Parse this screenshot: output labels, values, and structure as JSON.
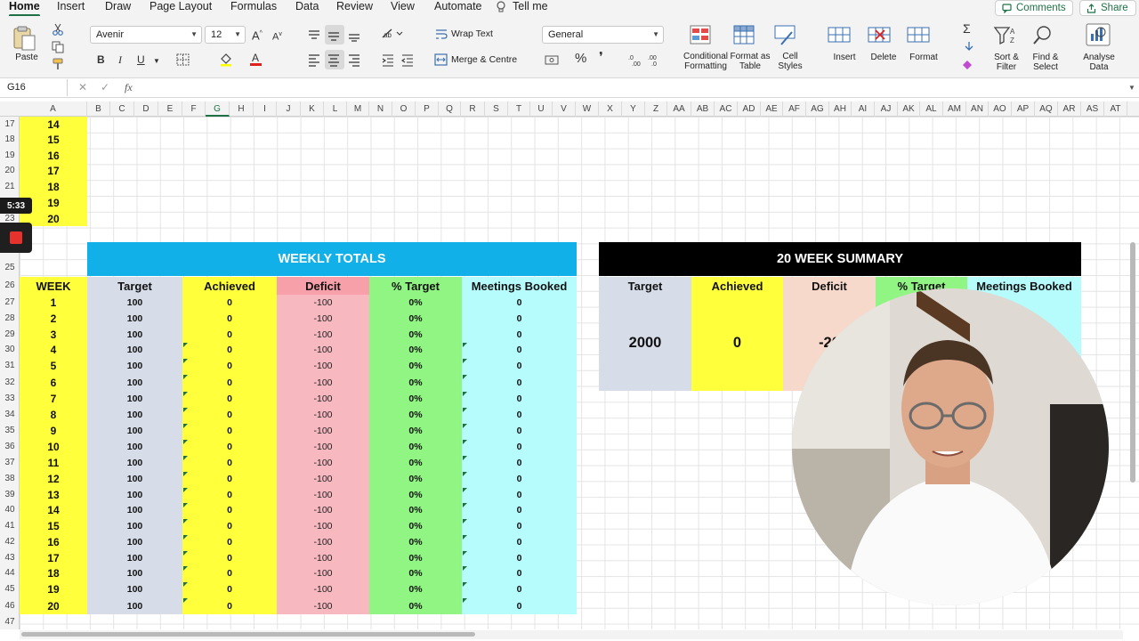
{
  "menu": {
    "tabs": [
      "Home",
      "Insert",
      "Draw",
      "Page Layout",
      "Formulas",
      "Data",
      "Review",
      "View",
      "Automate"
    ],
    "tell_me": "Tell me",
    "comments": "Comments",
    "share": "Share"
  },
  "ribbon": {
    "paste": "Paste",
    "font_name": "Avenir",
    "font_size": "12",
    "wrap_text": "Wrap Text",
    "merge_centre": "Merge & Centre",
    "number_format": "General",
    "conditional_formatting": "Conditional Formatting",
    "format_as_table": "Format as Table",
    "cell_styles": "Cell Styles",
    "insert": "Insert",
    "delete": "Delete",
    "format": "Format",
    "sort_filter": "Sort & Filter",
    "find_select": "Find & Select",
    "analyse_data": "Analyse Data",
    "bold": "B",
    "italic": "I",
    "underline": "U"
  },
  "formula_bar": {
    "name_box": "G16",
    "fx": "fx",
    "content": ""
  },
  "columns": [
    "A",
    "B",
    "C",
    "D",
    "E",
    "F",
    "G",
    "H",
    "I",
    "J",
    "K",
    "L",
    "M",
    "N",
    "O",
    "P",
    "Q",
    "R",
    "S",
    "T",
    "U",
    "V",
    "W",
    "X",
    "Y",
    "Z",
    "AA",
    "AB",
    "AC",
    "AD",
    "AE",
    "AF",
    "AG",
    "AH",
    "AI",
    "AJ",
    "AK",
    "AL",
    "AM",
    "AN",
    "AO",
    "AP",
    "AQ",
    "AR",
    "AS",
    "AT"
  ],
  "selected_column": "G",
  "rows": [
    "17",
    "18",
    "19",
    "20",
    "21",
    "22",
    "23",
    "",
    "25",
    "26",
    "27",
    "28",
    "29",
    "30",
    "31",
    "32",
    "33",
    "34",
    "35",
    "36",
    "37",
    "38",
    "39",
    "40",
    "41",
    "42",
    "43",
    "44",
    "45",
    "46",
    "47"
  ],
  "top_weeks": [
    "14",
    "15",
    "16",
    "17",
    "18",
    "19",
    "20"
  ],
  "weekly_totals": {
    "title": "WEEKLY TOTALS",
    "headers": [
      "WEEK",
      "Target",
      "Achieved",
      "Deficit",
      "% Target",
      "Meetings Booked"
    ],
    "rows": [
      [
        "1",
        "100",
        "0",
        "-100",
        "0%",
        "0"
      ],
      [
        "2",
        "100",
        "0",
        "-100",
        "0%",
        "0"
      ],
      [
        "3",
        "100",
        "0",
        "-100",
        "0%",
        "0"
      ],
      [
        "4",
        "100",
        "0",
        "-100",
        "0%",
        "0"
      ],
      [
        "5",
        "100",
        "0",
        "-100",
        "0%",
        "0"
      ],
      [
        "6",
        "100",
        "0",
        "-100",
        "0%",
        "0"
      ],
      [
        "7",
        "100",
        "0",
        "-100",
        "0%",
        "0"
      ],
      [
        "8",
        "100",
        "0",
        "-100",
        "0%",
        "0"
      ],
      [
        "9",
        "100",
        "0",
        "-100",
        "0%",
        "0"
      ],
      [
        "10",
        "100",
        "0",
        "-100",
        "0%",
        "0"
      ],
      [
        "11",
        "100",
        "0",
        "-100",
        "0%",
        "0"
      ],
      [
        "12",
        "100",
        "0",
        "-100",
        "0%",
        "0"
      ],
      [
        "13",
        "100",
        "0",
        "-100",
        "0%",
        "0"
      ],
      [
        "14",
        "100",
        "0",
        "-100",
        "0%",
        "0"
      ],
      [
        "15",
        "100",
        "0",
        "-100",
        "0%",
        "0"
      ],
      [
        "16",
        "100",
        "0",
        "-100",
        "0%",
        "0"
      ],
      [
        "17",
        "100",
        "0",
        "-100",
        "0%",
        "0"
      ],
      [
        "18",
        "100",
        "0",
        "-100",
        "0%",
        "0"
      ],
      [
        "19",
        "100",
        "0",
        "-100",
        "0%",
        "0"
      ],
      [
        "20",
        "100",
        "0",
        "-100",
        "0%",
        "0"
      ]
    ]
  },
  "summary": {
    "title": "20 WEEK SUMMARY",
    "headers": [
      "Target",
      "Achieved",
      "Deficit",
      "% Target",
      "Meetings Booked"
    ],
    "values": [
      "2000",
      "0",
      "-20"
    ]
  },
  "overlay": {
    "timer": "5:33"
  },
  "colors": {
    "excel_green": "#1e7145",
    "week_yellow": "#ffff3b",
    "weekly_header_blue": "#12b0e8",
    "target_blue": "#d6dde9",
    "deficit_pink": "#f7b8c0",
    "pct_green": "#90f582",
    "meetings_cyan": "#b7fcfd",
    "summary_black": "#000000",
    "summary_deficit": "#f7d9cb"
  }
}
